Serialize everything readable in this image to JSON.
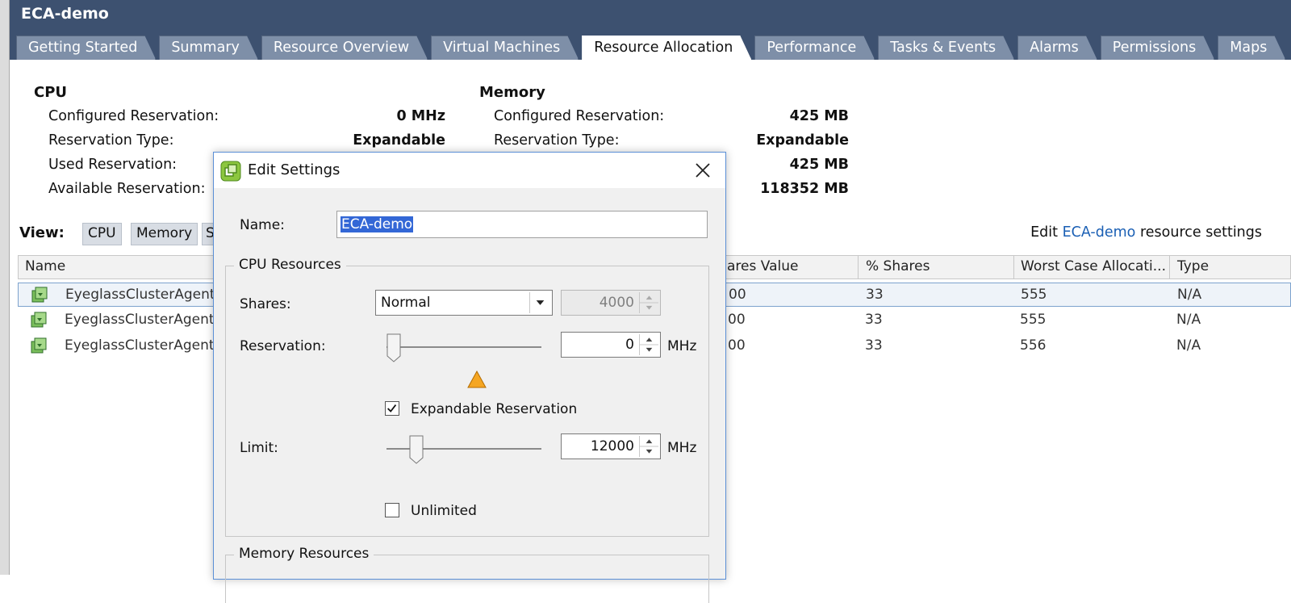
{
  "app": {
    "title": "ECA-demo"
  },
  "tabs": [
    {
      "label": "Getting Started",
      "active": false
    },
    {
      "label": "Summary",
      "active": false
    },
    {
      "label": "Resource Overview",
      "active": false
    },
    {
      "label": "Virtual Machines",
      "active": false
    },
    {
      "label": "Resource Allocation",
      "active": true
    },
    {
      "label": "Performance",
      "active": false
    },
    {
      "label": "Tasks & Events",
      "active": false
    },
    {
      "label": "Alarms",
      "active": false
    },
    {
      "label": "Permissions",
      "active": false
    },
    {
      "label": "Maps",
      "active": false
    }
  ],
  "cpu": {
    "title": "CPU",
    "rows": [
      {
        "label": "Configured Reservation:",
        "value": "0 MHz"
      },
      {
        "label": "Reservation Type:",
        "value": "Expandable"
      },
      {
        "label": "Used Reservation:",
        "value": ""
      },
      {
        "label": "Available Reservation:",
        "value": ""
      }
    ]
  },
  "memory": {
    "title": "Memory",
    "rows": [
      {
        "label": "Configured Reservation:",
        "value": "425 MB"
      },
      {
        "label": "Reservation Type:",
        "value": "Expandable"
      },
      {
        "label": "Used Reservation:",
        "value": "425 MB"
      },
      {
        "label": "Available Reservation:",
        "value": "118352 MB"
      }
    ]
  },
  "view": {
    "label": "View:",
    "buttons": [
      "CPU",
      "Memory",
      "S"
    ],
    "edit_prefix": "Edit",
    "edit_link": "ECA-demo",
    "edit_suffix": "resource settings"
  },
  "table": {
    "columns": [
      "Name",
      "ares Value",
      "% Shares",
      "Worst Case Allocati...",
      "Type"
    ],
    "rows": [
      {
        "name": "EyeglassClusterAgent",
        "shares_value": "00",
        "pct_shares": "33",
        "worst_case": "555",
        "type": "N/A"
      },
      {
        "name": "EyeglassClusterAgent",
        "shares_value": "00",
        "pct_shares": "33",
        "worst_case": "555",
        "type": "N/A"
      },
      {
        "name": "EyeglassClusterAgent",
        "shares_value": "00",
        "pct_shares": "33",
        "worst_case": "556",
        "type": "N/A"
      }
    ]
  },
  "dialog": {
    "title": "Edit Settings",
    "name_label": "Name:",
    "name_value": "ECA-demo",
    "cpu_legend": "CPU Resources",
    "shares_label": "Shares:",
    "shares_selected": "Normal",
    "shares_value": "4000",
    "reservation_label": "Reservation:",
    "reservation_value": "0",
    "reservation_unit": "MHz",
    "expandable_label": "Expandable Reservation",
    "expandable_checked": true,
    "limit_label": "Limit:",
    "limit_value": "12000",
    "limit_unit": "MHz",
    "unlimited_label": "Unlimited",
    "unlimited_checked": false,
    "memory_legend": "Memory Resources"
  }
}
